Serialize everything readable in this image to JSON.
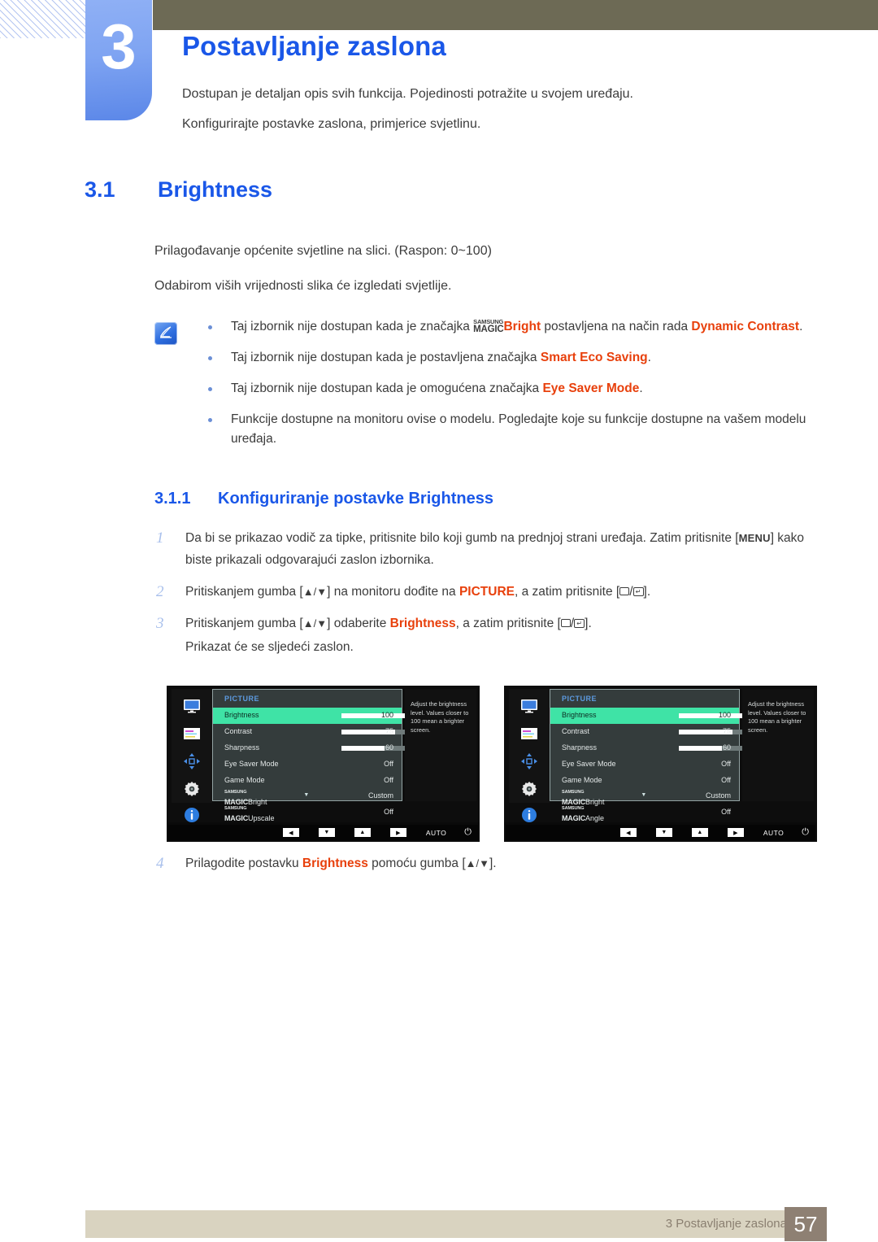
{
  "chapter": {
    "number": "3",
    "title": "Postavljanje zaslona",
    "sub1": "Dostupan je detaljan opis svih funkcija. Pojedinosti potražite u svojem uređaju.",
    "sub2": "Konfigurirajte postavke zaslona, primjerice svjetlinu."
  },
  "section": {
    "number": "3.1",
    "title": "Brightness",
    "para1": "Prilagođavanje općenite svjetline na slici. (Raspon: 0~100)",
    "para2": "Odabirom viših vrijednosti slika će izgledati svjetlije."
  },
  "note": {
    "icon": "note-pen-icon",
    "bullets": [
      {
        "pre": "Taj izbornik nije dostupan kada je značajka ",
        "magic_small": "SAMSUNG",
        "magic_main": "MAGIC",
        "magic_suffix": "Bright",
        "mid": " postavljena na način rada ",
        "highlight": "Dynamic Contrast",
        "post": "."
      },
      {
        "pre": "Taj izbornik nije dostupan kada je postavljena značajka ",
        "highlight": "Smart Eco Saving",
        "post": "."
      },
      {
        "pre": "Taj izbornik nije dostupan kada je omogućena značajka ",
        "highlight": "Eye Saver Mode",
        "post": "."
      },
      {
        "pre": "Funkcije dostupne na monitoru ovise o modelu. Pogledajte koje su funkcije dostupne na vašem modelu uređaja.",
        "highlight": "",
        "post": ""
      }
    ]
  },
  "subsection": {
    "number": "3.1.1",
    "title": "Konfiguriranje postavke Brightness"
  },
  "steps": [
    {
      "index": "1",
      "text_a": "Da bi se prikazao vodič za tipke, pritisnite bilo koji gumb na prednjoj strani uređaja. Zatim pritisnite [",
      "key": "MENU",
      "text_b": "] kako biste prikazali odgovarajući zaslon izbornika."
    },
    {
      "index": "2",
      "text_a": "Pritiskanjem gumba [",
      "keys": "▲/▼",
      "text_b": "] na monitoru dođite na ",
      "highlight": "PICTURE",
      "text_c": ", a zatim pritisnite [",
      "text_d": "]."
    },
    {
      "index": "3",
      "text_a": "Pritiskanjem gumba [",
      "keys": "▲/▼",
      "text_b": "] odaberite ",
      "highlight": "Brightness",
      "text_c": ", a zatim pritisnite [",
      "text_d": "].",
      "note": "Prikazat će se sljedeći zaslon."
    },
    {
      "index": "4",
      "text_a": "Prilagodite postavku ",
      "highlight": "Brightness",
      "text_b": " pomoću gumba [",
      "keys": "▲/▼",
      "text_c": "]."
    }
  ],
  "osd": {
    "title": "PICTURE",
    "tooltip": "Adjust the brightness level. Values closer to 100 mean a brighter screen.",
    "footer": {
      "buttons": [
        "◀",
        "▼",
        "▲",
        "▶"
      ],
      "auto": "AUTO",
      "power": "⏻"
    },
    "rail_icons": [
      "monitor-icon",
      "color-bars-icon",
      "position-arrows-icon",
      "gear-icon",
      "info-icon"
    ],
    "caret": "▼",
    "highlight_color": "#3fe3a6",
    "left": {
      "rows": [
        {
          "label": "Brightness",
          "value": "100",
          "bar": 100,
          "highlighted": true
        },
        {
          "label": "Contrast",
          "value": "75",
          "bar": 75,
          "highlighted": false
        },
        {
          "label": "Sharpness",
          "value": "60",
          "bar": 60,
          "highlighted": false
        },
        {
          "label": "Eye Saver Mode",
          "value": "Off",
          "bar": null,
          "highlighted": false
        },
        {
          "label": "Game Mode",
          "value": "Off",
          "bar": null,
          "highlighted": false
        },
        {
          "label": "Bright",
          "value": "Custom",
          "bar": null,
          "highlighted": false,
          "magic": true
        },
        {
          "label": "Upscale",
          "value": "Off",
          "bar": null,
          "highlighted": false,
          "magic": true
        }
      ]
    },
    "right": {
      "rows": [
        {
          "label": "Brightness",
          "value": "100",
          "bar": 100,
          "highlighted": true
        },
        {
          "label": "Contrast",
          "value": "75",
          "bar": 75,
          "highlighted": false
        },
        {
          "label": "Sharpness",
          "value": "60",
          "bar": 60,
          "highlighted": false
        },
        {
          "label": "Eye Saver Mode",
          "value": "Off",
          "bar": null,
          "highlighted": false
        },
        {
          "label": "Game Mode",
          "value": "Off",
          "bar": null,
          "highlighted": false
        },
        {
          "label": "Bright",
          "value": "Custom",
          "bar": null,
          "highlighted": false,
          "magic": true
        },
        {
          "label": "Angle",
          "value": "Off",
          "bar": null,
          "highlighted": false,
          "magic": true
        }
      ]
    },
    "magic_small": "SAMSUNG",
    "magic_main": "MAGIC"
  },
  "footer": {
    "text": "3 Postavljanje zaslona",
    "page": "57"
  },
  "colors": {
    "accent_blue": "#1a57e8",
    "header_olive": "#6d6a55",
    "highlight_red": "#e8400c",
    "footer_beige": "#d9d3c0",
    "page_box": "#8e8073"
  }
}
